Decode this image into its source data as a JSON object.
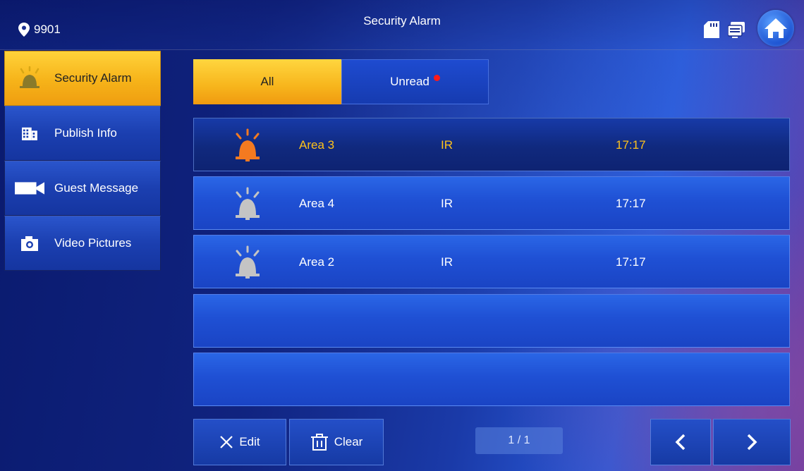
{
  "header": {
    "location": "9901",
    "title": "Security Alarm"
  },
  "sidebar": {
    "items": [
      {
        "label": "Security Alarm",
        "icon": "bell-icon",
        "active": true
      },
      {
        "label": "Publish Info",
        "icon": "building-icon",
        "active": false
      },
      {
        "label": "Guest Message",
        "icon": "video-camera-icon",
        "active": false
      },
      {
        "label": "Video Pictures",
        "icon": "camera-icon",
        "active": false
      }
    ]
  },
  "tabs": {
    "all": "All",
    "unread": "Unread"
  },
  "alarms": [
    {
      "area": "Area 3",
      "type": "IR",
      "time": "17:17",
      "selected": true,
      "bell_color": "#f47a20"
    },
    {
      "area": "Area 4",
      "type": "IR",
      "time": "17:17",
      "selected": false,
      "bell_color": "#c4c4c4"
    },
    {
      "area": "Area 2",
      "type": "IR",
      "time": "17:17",
      "selected": false,
      "bell_color": "#c4c4c4"
    }
  ],
  "toolbar": {
    "edit_label": "Edit",
    "clear_label": "Clear",
    "page": "1 / 1"
  },
  "colors": {
    "accent_yellow": "#f7b51c",
    "alert_red": "#ff1a1a",
    "selected_text": "#ffc21a"
  }
}
